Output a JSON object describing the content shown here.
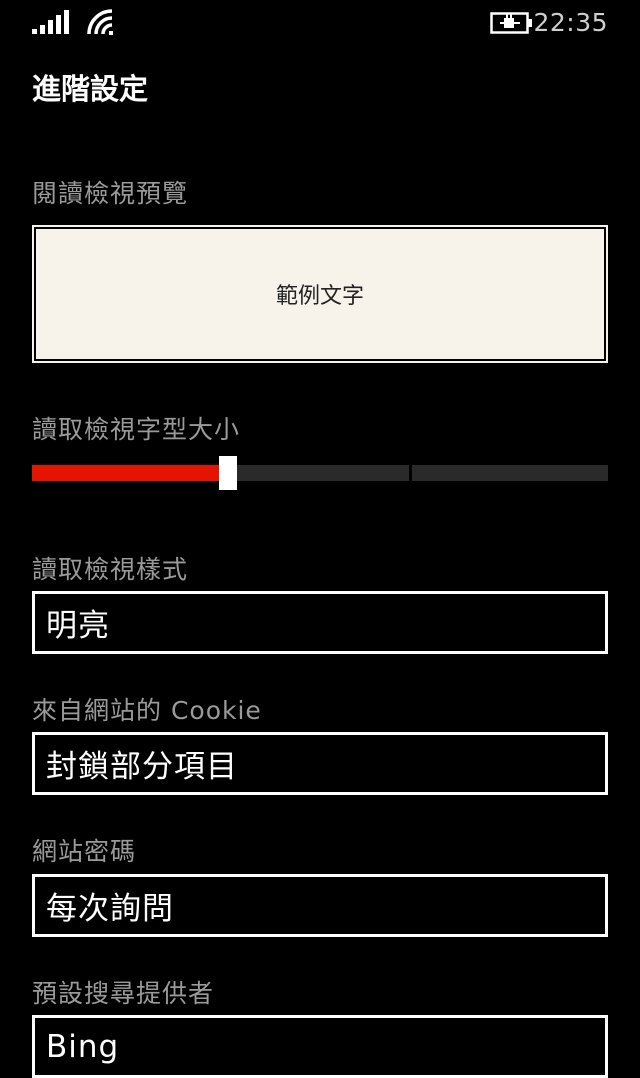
{
  "status_bar": {
    "signal_icon": "signal-strength-icon",
    "wifi_icon": "wifi-icon",
    "battery_icon": "battery-charging-icon",
    "time": "22:35"
  },
  "page": {
    "title": "進階設定"
  },
  "reading_preview": {
    "label": "閱讀檢視預覽",
    "sample_text": "範例文字"
  },
  "font_size": {
    "label": "讀取檢視字型大小",
    "level_percent": 34,
    "accent_color": "#e51400"
  },
  "reading_style": {
    "label": "讀取檢視樣式",
    "value": "明亮"
  },
  "cookies": {
    "label": "來自網站的 Cookie",
    "value": "封鎖部分項目"
  },
  "passwords": {
    "label": "網站密碼",
    "value": "每次詢問"
  },
  "search_provider": {
    "label": "預設搜尋提供者",
    "value": "Bing"
  }
}
